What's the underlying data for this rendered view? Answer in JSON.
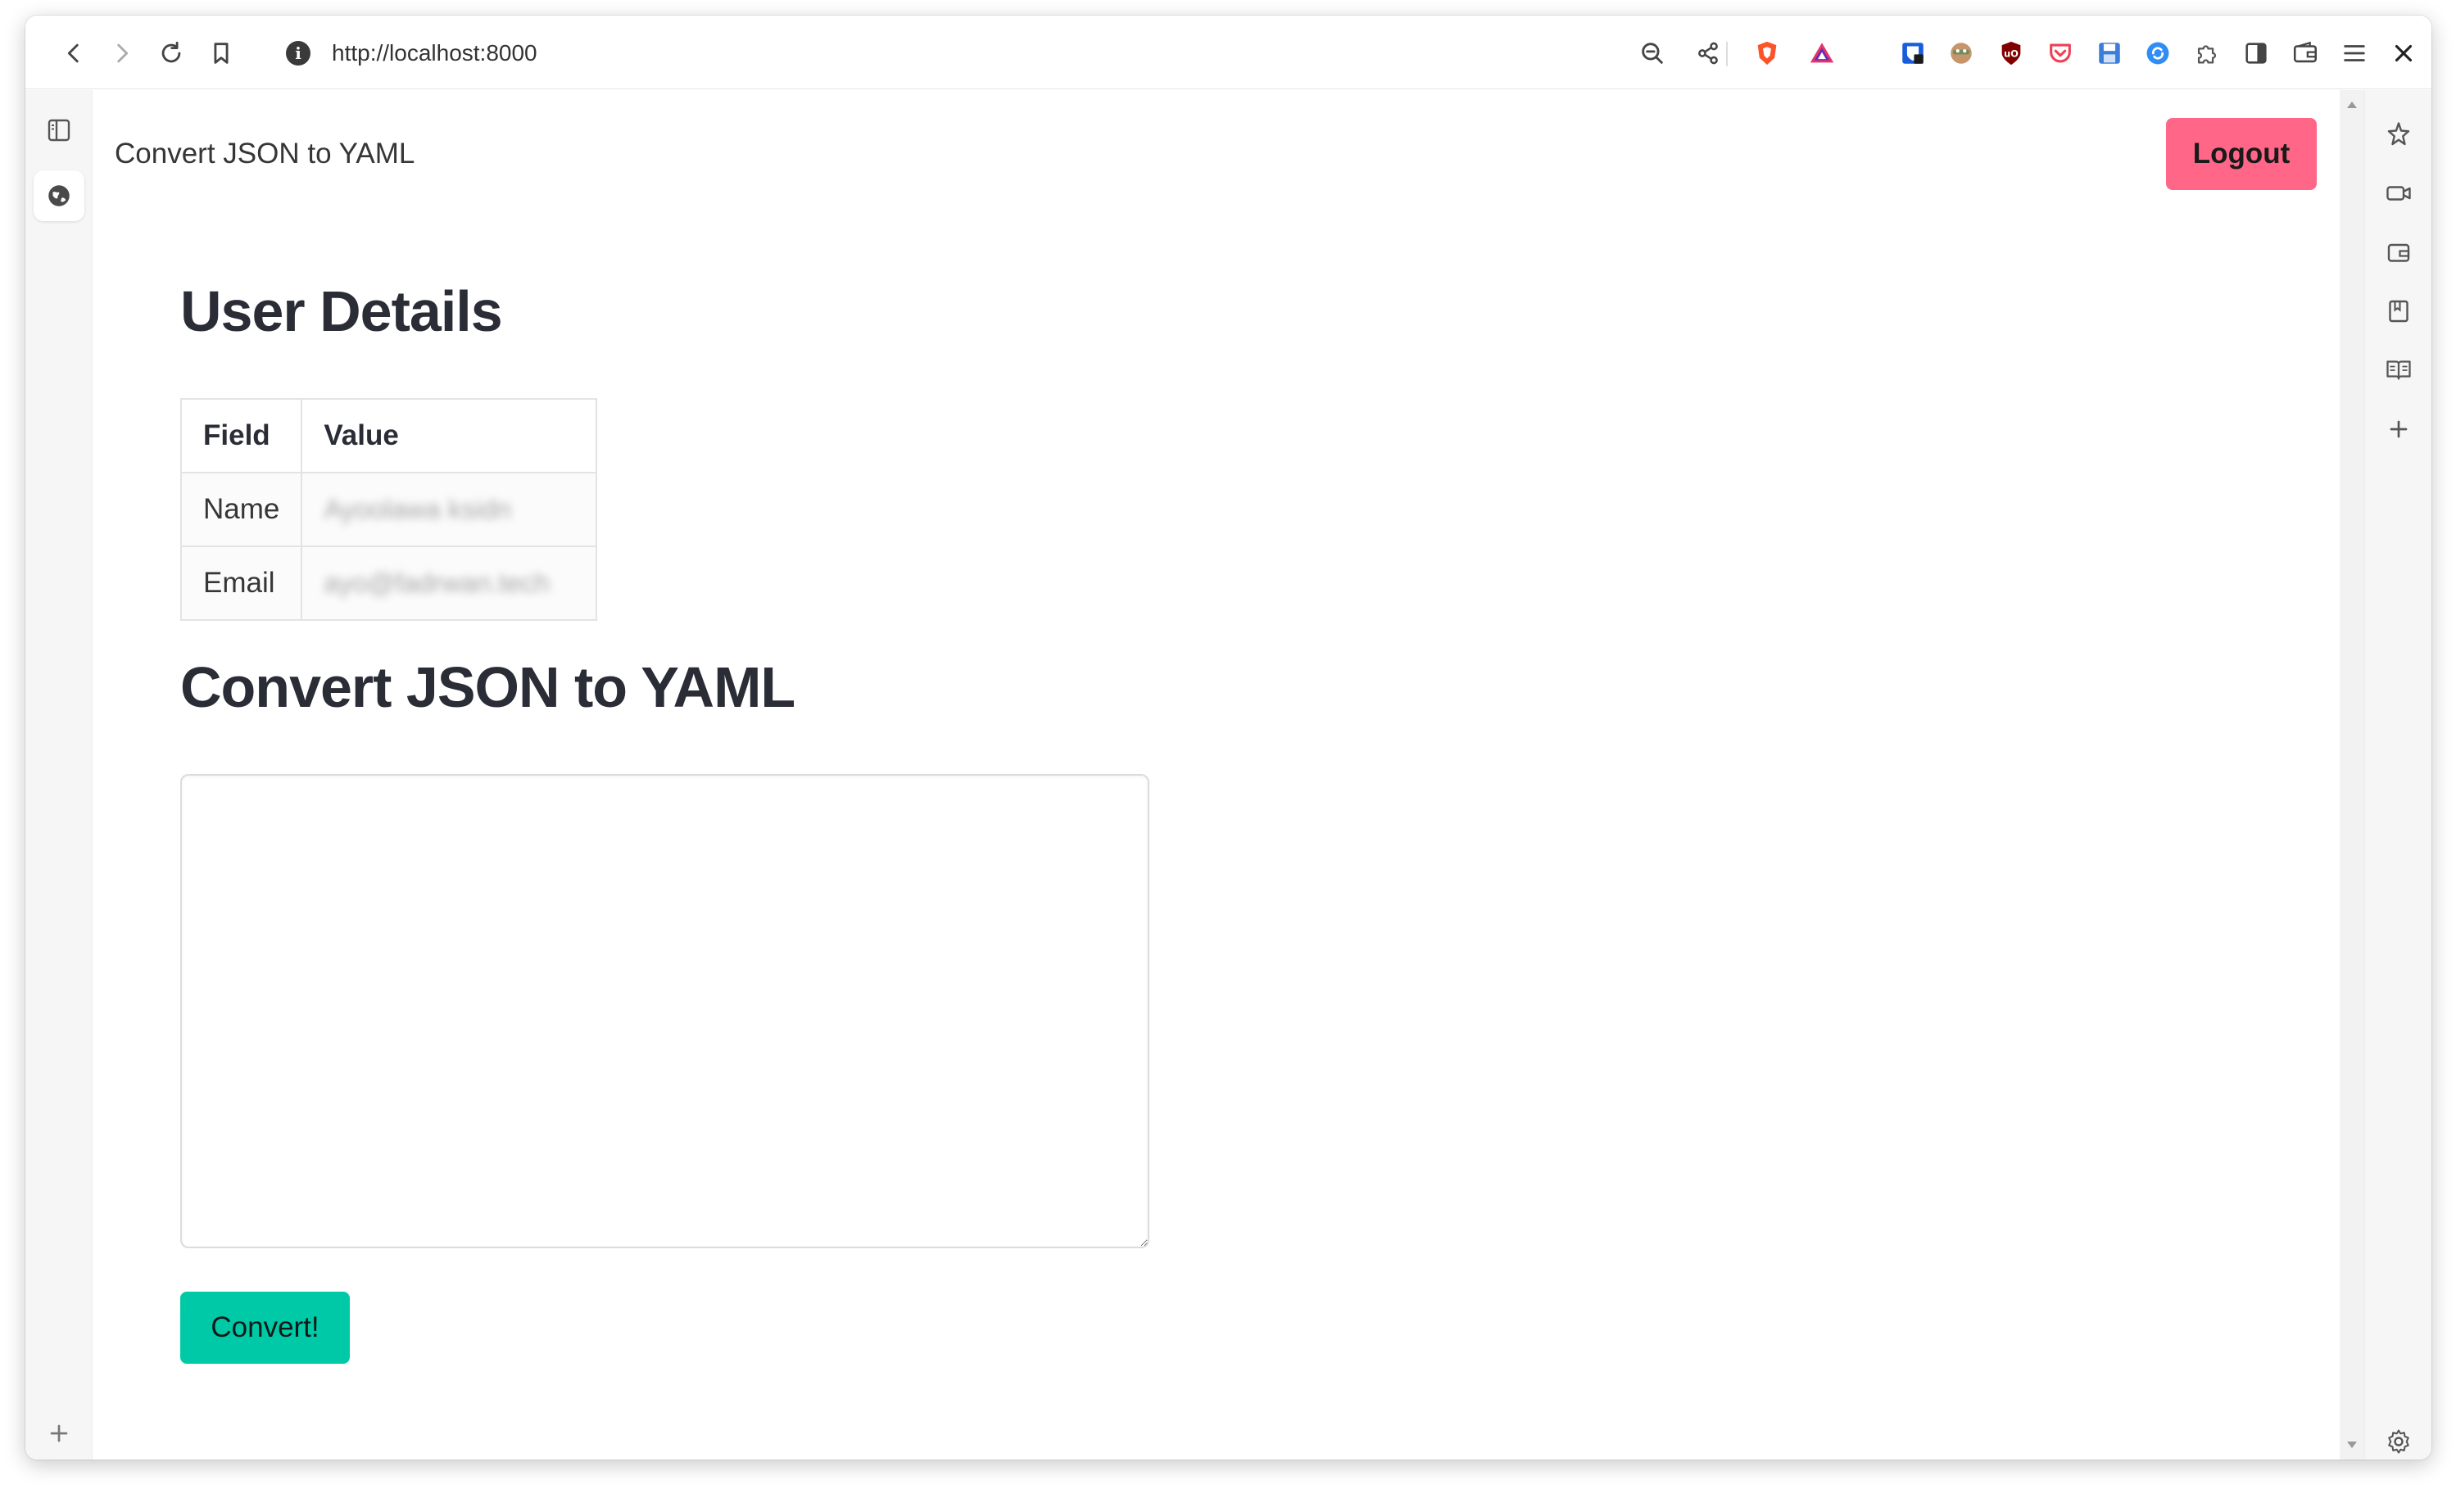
{
  "browser": {
    "url": "http://localhost:8000",
    "info_glyph": "i"
  },
  "page": {
    "brand": "Convert JSON to YAML",
    "logout_label": "Logout",
    "user_details_title": "User Details",
    "table": {
      "headers": [
        "Field",
        "Value"
      ],
      "rows": [
        {
          "field": "Name",
          "value": "Ayoolawa ksidn"
        },
        {
          "field": "Email",
          "value": "ayo@fadrwan.tech"
        }
      ]
    },
    "convert_title": "Convert JSON to YAML",
    "textarea_value": "",
    "convert_label": "Convert!"
  },
  "colors": {
    "logout": "#ff6688",
    "convert": "#00c9a7",
    "heading": "#2a2d36"
  },
  "icons": {
    "toolbar": [
      "back-icon",
      "forward-icon",
      "reload-icon",
      "bookmark-icon",
      "zoom-out-icon",
      "share-icon",
      "brave-shield-icon",
      "brave-rewards-icon",
      "bitwarden-icon",
      "extension-icon",
      "ublock-icon",
      "pocket-icon",
      "save-icon",
      "sync-icon",
      "puzzle-icon",
      "sidebar-toggle-icon",
      "wallet-icon",
      "menu-icon",
      "close-icon"
    ],
    "right_panel": [
      "leo-icon",
      "video-icon",
      "wallet-icon",
      "bookmark-icon",
      "reading-list-icon",
      "plus-icon",
      "settings-icon"
    ]
  }
}
